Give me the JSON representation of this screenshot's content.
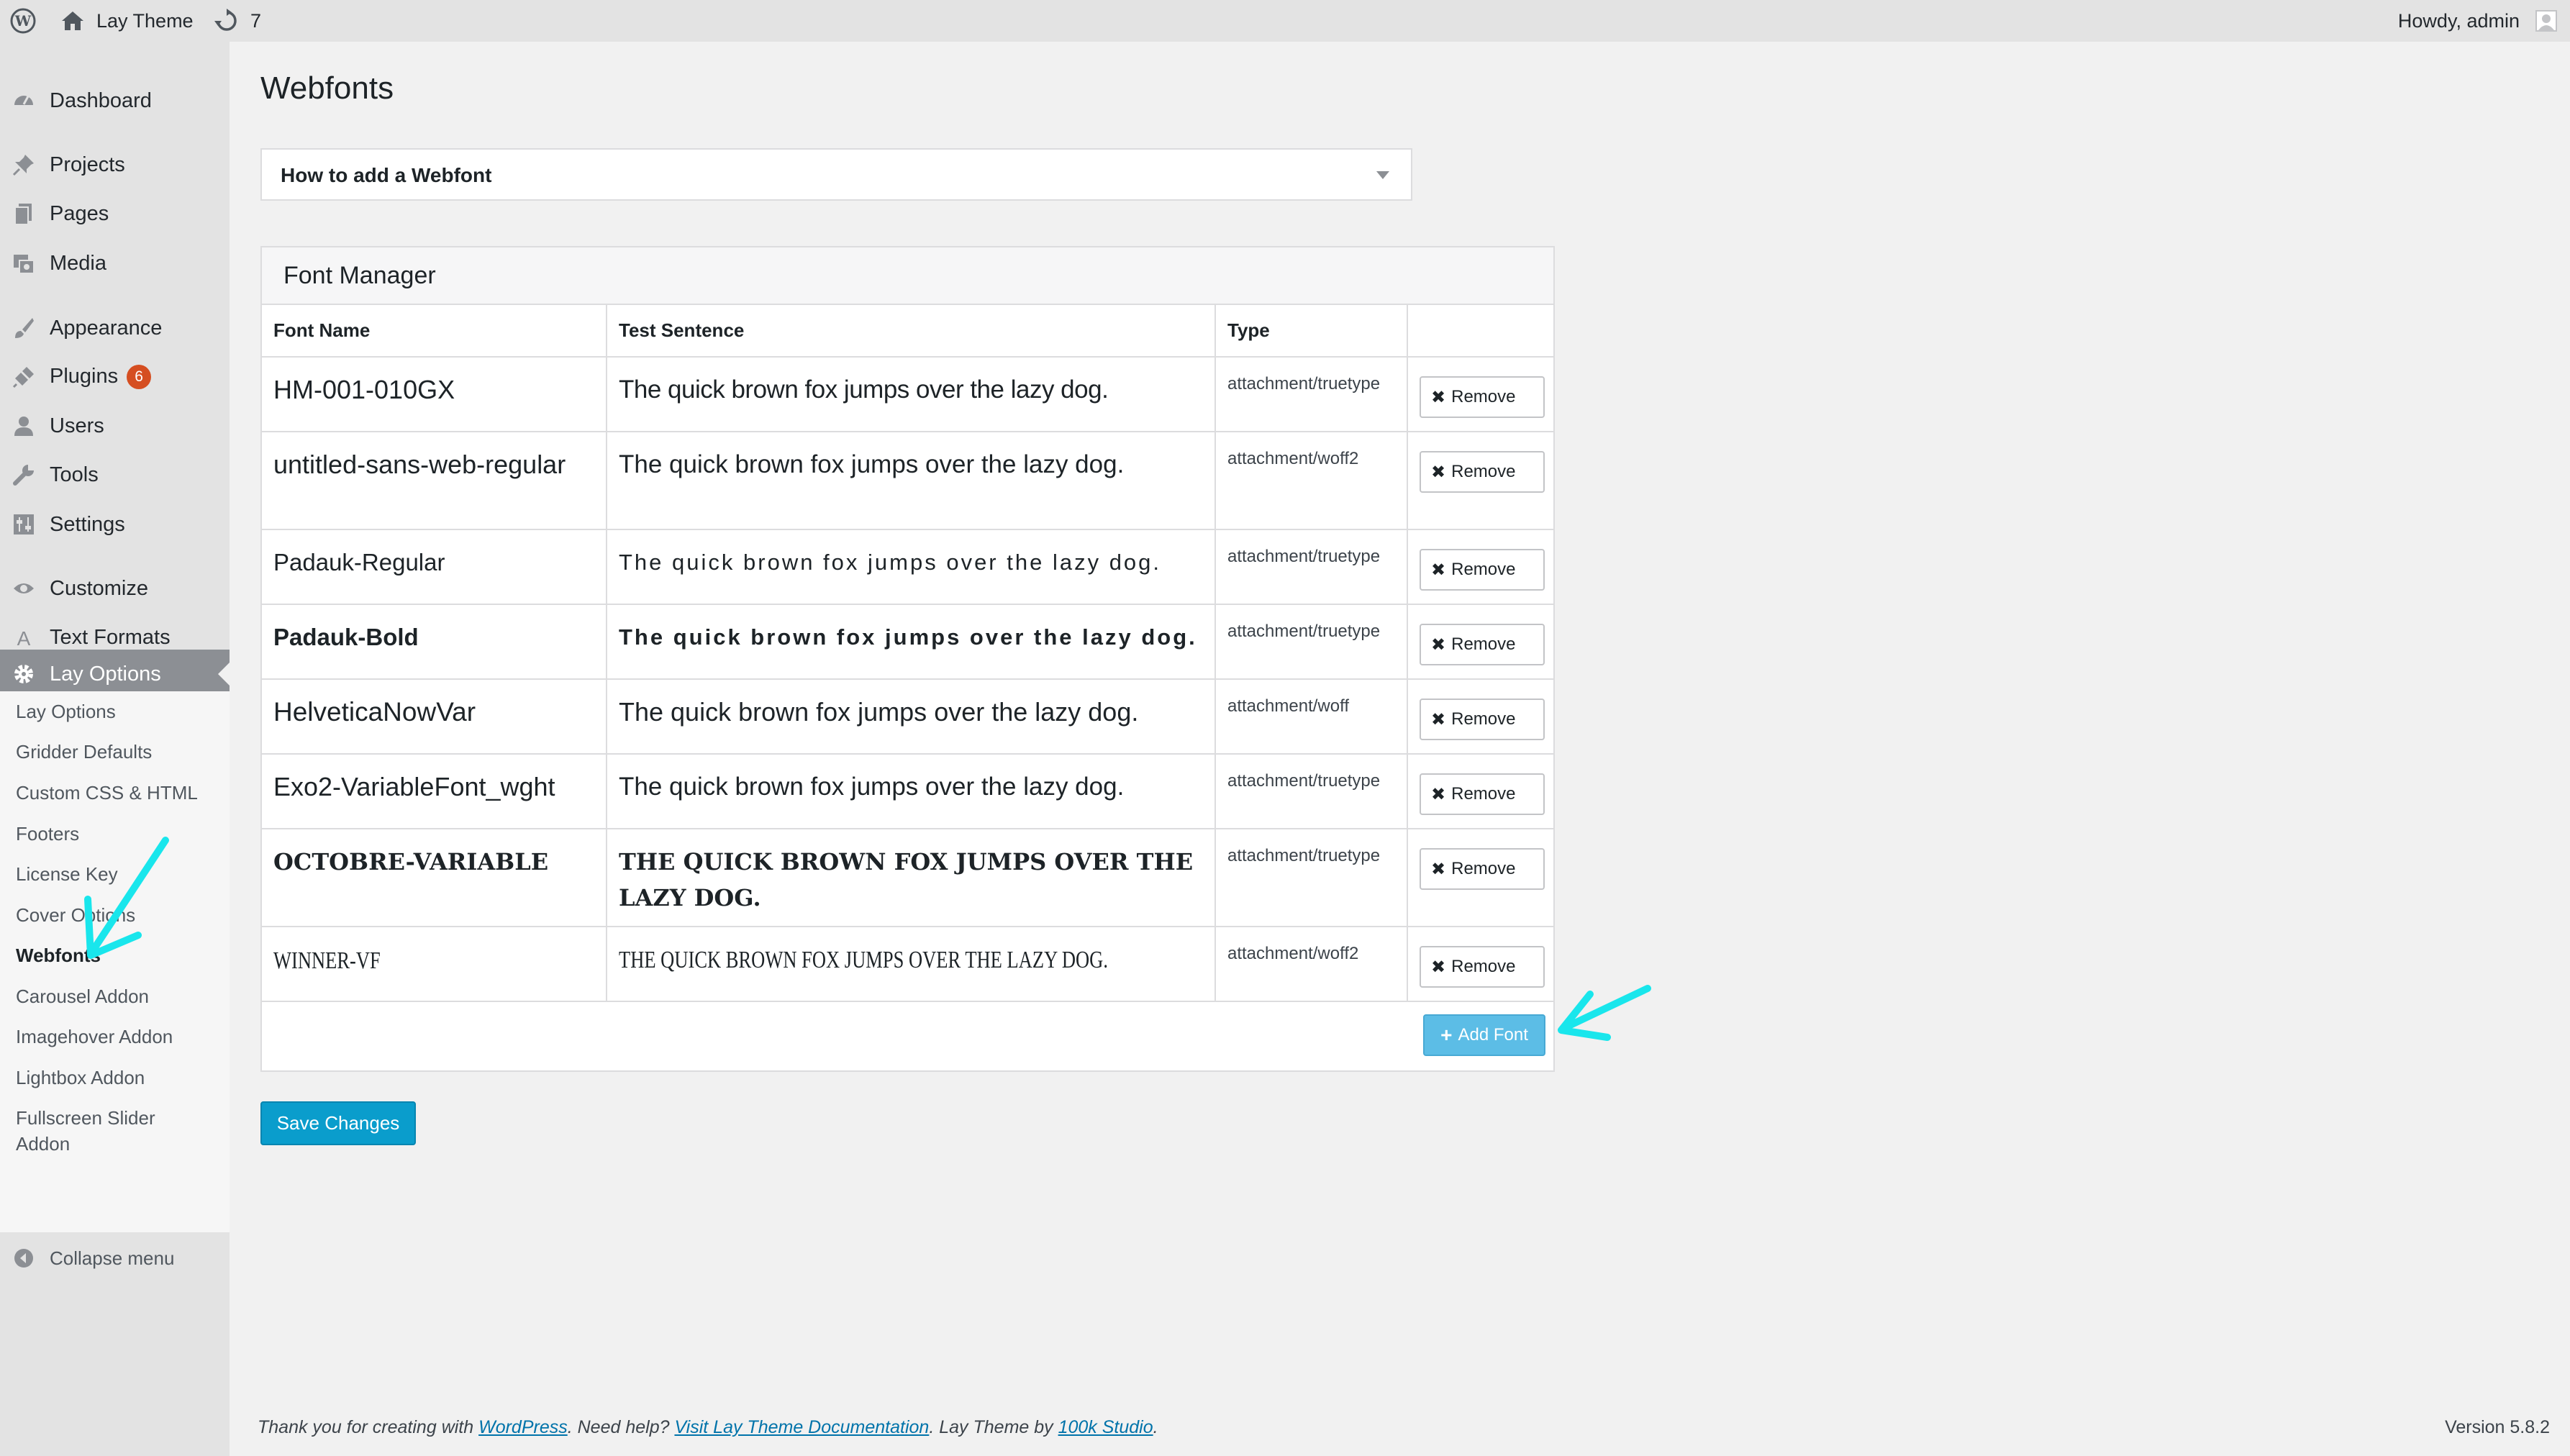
{
  "adminbar": {
    "site_name": "Lay Theme",
    "updates_count": "7",
    "greeting": "Howdy, admin"
  },
  "sidebar": {
    "items": [
      {
        "label": "Dashboard",
        "icon": "dashboard-icon"
      },
      {
        "label": "Projects",
        "icon": "pin-icon"
      },
      {
        "label": "Pages",
        "icon": "pages-icon"
      },
      {
        "label": "Media",
        "icon": "media-icon"
      },
      {
        "label": "Appearance",
        "icon": "brush-icon"
      },
      {
        "label": "Plugins",
        "icon": "plugin-icon",
        "badge": "6"
      },
      {
        "label": "Users",
        "icon": "user-icon"
      },
      {
        "label": "Tools",
        "icon": "wrench-icon"
      },
      {
        "label": "Settings",
        "icon": "settings-icon"
      },
      {
        "label": "Customize",
        "icon": "eye-icon"
      },
      {
        "label": "Text Formats",
        "icon": "letter-a-icon"
      },
      {
        "label": "Lay Options",
        "icon": "gear-icon"
      }
    ],
    "submenu": [
      "Lay Options",
      "Gridder Defaults",
      "Custom CSS & HTML",
      "Footers",
      "License Key",
      "Cover Options",
      "Webfonts",
      "Carousel Addon",
      "Imagehover Addon",
      "Lightbox Addon",
      "Fullscreen Slider Addon"
    ],
    "collapse_label": "Collapse menu"
  },
  "page": {
    "title": "Webfonts",
    "howto_label": "How to add a Webfont"
  },
  "font_manager": {
    "title": "Font Manager",
    "columns": [
      "Font Name",
      "Test Sentence",
      "Type",
      ""
    ],
    "remove_label": "Remove",
    "add_label": "Add Font",
    "rows": [
      {
        "name": "HM-001-010GX",
        "sentence": "The quick brown fox jumps over the lazy dog.",
        "type": "attachment/truetype"
      },
      {
        "name": "untitled-sans-web-regular",
        "sentence": "The quick brown fox jumps over the lazy dog.",
        "type": "attachment/woff2"
      },
      {
        "name": "Padauk-Regular",
        "sentence": "The quick brown fox jumps over the lazy dog.",
        "type": "attachment/truetype"
      },
      {
        "name": "Padauk-Bold",
        "sentence": "The quick brown fox jumps over the lazy dog.",
        "type": "attachment/truetype"
      },
      {
        "name": "HelveticaNowVar",
        "sentence": "The quick brown fox jumps over the lazy dog.",
        "type": "attachment/woff"
      },
      {
        "name": "Exo2-VariableFont_wght",
        "sentence": "The quick brown fox jumps over the lazy dog.",
        "type": "attachment/truetype"
      },
      {
        "name": "OCTOBRE-VARIABLE",
        "sentence": "THE QUICK BROWN FOX JUMPS OVER THE LAZY DOG.",
        "type": "attachment/truetype"
      },
      {
        "name": "WINNER-VF",
        "sentence": "THE QUICK BROWN FOX JUMPS OVER THE LAZY DOG.",
        "type": "attachment/woff2"
      }
    ]
  },
  "actions": {
    "save_label": "Save Changes"
  },
  "footer": {
    "text_1": "Thank you for creating with ",
    "link_wordpress": "WordPress",
    "text_2": ". Need help? ",
    "link_docs": "Visit Lay Theme Documentation",
    "text_3": ". Lay Theme by ",
    "link_studio": "100k Studio",
    "text_4": ".",
    "version": "Version 5.8.2"
  },
  "colors": {
    "annotation_arrow": "#19e6ec",
    "primary_button": "#0a9dcc",
    "add_font_button": "#5cbde6",
    "active_menu": "#8c8f94",
    "plugin_badge": "#d54e21"
  }
}
